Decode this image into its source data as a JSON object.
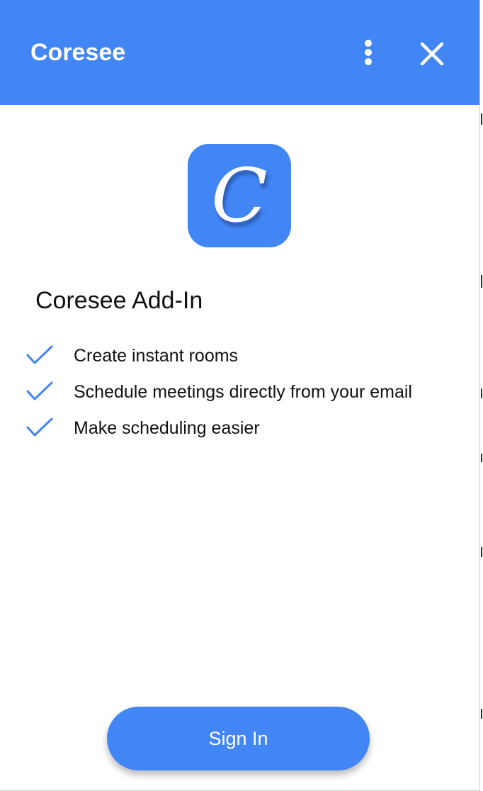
{
  "header": {
    "app_title": "Coresee",
    "menu_icon": "more-vertical-icon",
    "close_icon": "close-icon"
  },
  "logo": {
    "letter": "C",
    "icon": "coresee-logo-icon"
  },
  "addin": {
    "title": "Coresee Add-In",
    "features": [
      "Create instant rooms",
      "Schedule meetings directly from your email",
      "Make scheduling easier"
    ],
    "check_icon": "checkmark-icon"
  },
  "signin": {
    "label": "Sign In"
  },
  "colors": {
    "accent": "#4285f4",
    "header_text": "#ffffff",
    "body_text": "#111111",
    "background": "#ffffff"
  }
}
